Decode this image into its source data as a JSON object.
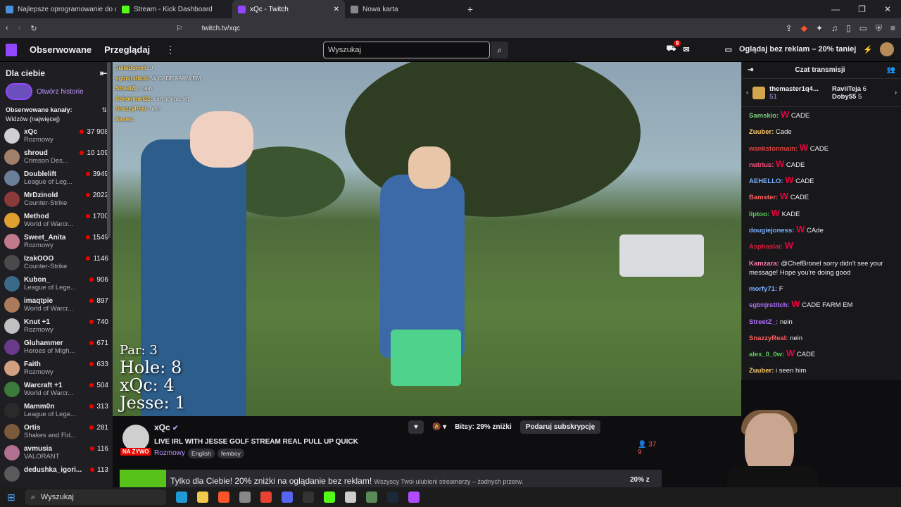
{
  "browser": {
    "tabs": [
      {
        "label": "Najlepsze oprogramowanie do ulepsz",
        "color": "#4a90d9"
      },
      {
        "label": "Stream - Kick Dashboard",
        "color": "#53fc18"
      },
      {
        "label": "xQc - Twitch",
        "color": "#9147ff"
      },
      {
        "label": "Nowa karta",
        "color": "#888888"
      }
    ],
    "url": "twitch.tv/xqc"
  },
  "header": {
    "followed": "Obserwowane",
    "browse": "Przeglądaj",
    "search_placeholder": "Wyszukaj",
    "notif_count": "9",
    "ad_free": "Oglądaj bez reklam – 20% taniej"
  },
  "sidebar": {
    "title": "Dla ciebie",
    "stories": "Otwórz historie",
    "followed_label": "Obserwowane kanały:",
    "sort": "Widzów (najwięcej)",
    "channels": [
      {
        "name": "xQc",
        "cat": "Rozmowy",
        "viewers": "37 908",
        "color": "#d0d0d0"
      },
      {
        "name": "shroud",
        "cat": "Crimson Des...",
        "viewers": "10 109",
        "color": "#a0806a"
      },
      {
        "name": "Doublelift",
        "cat": "League of Leg...",
        "viewers": "3949",
        "color": "#6a7f9a"
      },
      {
        "name": "MrDzinold",
        "cat": "Counter-Strike",
        "viewers": "2022",
        "color": "#8a3a3a"
      },
      {
        "name": "Method",
        "cat": "World of Warcr...",
        "viewers": "1700",
        "color": "#e0a030"
      },
      {
        "name": "Sweet_Anita",
        "cat": "Rozmowy",
        "viewers": "1549",
        "color": "#c07a8a"
      },
      {
        "name": "IzakOOO",
        "cat": "Counter-Strike",
        "viewers": "1146",
        "color": "#4a4a4a"
      },
      {
        "name": "Kubon_",
        "cat": "League of Lege...",
        "viewers": "906",
        "color": "#3a6a8a"
      },
      {
        "name": "imaqtpie",
        "cat": "World of Warcr...",
        "viewers": "897",
        "color": "#aa7a5a"
      },
      {
        "name": "Knut +1",
        "cat": "Rozmowy",
        "viewers": "740",
        "color": "#c0c0c0"
      },
      {
        "name": "Gluhammer",
        "cat": "Heroes of Migh...",
        "viewers": "671",
        "color": "#6a3a8a"
      },
      {
        "name": "Faith",
        "cat": "Rozmowy",
        "viewers": "633",
        "color": "#d0a080"
      },
      {
        "name": "Warcraft +1",
        "cat": "World of Warcr...",
        "viewers": "504",
        "color": "#3a7a3a"
      },
      {
        "name": "Mamm0n",
        "cat": "League of Lege...",
        "viewers": "313",
        "color": "#2a2a2a"
      },
      {
        "name": "Ortis",
        "cat": "Shakes and Fid...",
        "viewers": "281",
        "color": "#7a5a3a"
      },
      {
        "name": "avmusia",
        "cat": "VALORANT",
        "viewers": "116",
        "color": "#b07090"
      },
      {
        "name": "dedushka_igori...",
        "cat": "",
        "viewers": "113",
        "color": "#5a5a5a"
      }
    ]
  },
  "video": {
    "overlay_chat": [
      {
        "user": "JuliaBurrell:",
        "msg": "9"
      },
      {
        "user": "sgtmjrstitch:",
        "msg": "W CADE FARM EM"
      },
      {
        "user": "StreetZ_:",
        "msg": "nein"
      },
      {
        "user": "Schommel32:",
        "msg": "can gonna set"
      },
      {
        "user": "SnazzyReal:",
        "msg": "nein"
      },
      {
        "user": "Xenex:",
        "msg": ""
      }
    ],
    "score": {
      "par": "Par: 3",
      "hole": "Hole: 8",
      "xqc": "xQc: 4",
      "jesse": "Jesse: 1"
    }
  },
  "stream": {
    "name": "xQc",
    "live": "NA ŻYWO",
    "title": "LIVE IRL WITH JESSE GOLF STREAM REAL PULL UP QUICK",
    "category": "Rozmowy",
    "tags": [
      "English",
      "femboy"
    ],
    "bits": "Bitsy: 29% zniżki",
    "gift": "Podaruj subskrypcję",
    "viewers": "37 9",
    "promo_main": "Tylko dla Ciebie! 20% zniżki na oglądanie bez reklam!",
    "promo_sub": "Wszyscy Twoi ulubieni streamerzy – żadnych przerw.",
    "promo_badge": "20% z"
  },
  "chat": {
    "title": "Czat transmisji",
    "pinned": [
      {
        "name": "themaster1q4...",
        "count": "51"
      },
      {
        "name": "RaviiTeja",
        "count": "6"
      },
      {
        "name": "Doby55",
        "count": "5"
      }
    ],
    "messages": [
      {
        "user": "Samskio:",
        "color": "#7cd07c",
        "w": "W",
        "text": "CADE"
      },
      {
        "user": "Zuuber:",
        "color": "#ffcc66",
        "w": "",
        "text": "Cade"
      },
      {
        "user": "wankstonmain:",
        "color": "#e04040",
        "w": "W",
        "text": "CADE"
      },
      {
        "user": "nutrius:",
        "color": "#ff5080",
        "w": "W",
        "text": "CADE"
      },
      {
        "user": "AEHELLO:",
        "color": "#7ab0ff",
        "w": "W",
        "text": "CADE"
      },
      {
        "user": "Bamster:",
        "color": "#ff6060",
        "w": "W",
        "text": "CADE"
      },
      {
        "user": "liptoo:",
        "color": "#5ad05a",
        "w": "W",
        "text": "KADE"
      },
      {
        "user": "dougiejoness:",
        "color": "#7ab0ff",
        "w": "W",
        "text": "CAde"
      },
      {
        "user": "Asphaslai:",
        "color": "#d02040",
        "w": "W",
        "text": ""
      },
      {
        "user": "Kamzara:",
        "color": "#ff7ab0",
        "w": "",
        "text": "@ChefBronel sorry didn't see your message! Hope you're doing good"
      },
      {
        "user": "morfy71:",
        "color": "#7ab0ff",
        "w": "",
        "text": "F"
      },
      {
        "user": "sgtmjrstitch:",
        "color": "#b070ff",
        "w": "W",
        "text": "CADE FARM EM"
      },
      {
        "user": "StreetZ_:",
        "color": "#b070ff",
        "w": "",
        "text": "nein"
      },
      {
        "user": "SnazzyReal:",
        "color": "#ff6060",
        "w": "",
        "text": "nein"
      },
      {
        "user": "alex_0_0w:",
        "color": "#5ad05a",
        "w": "W",
        "text": "CADE"
      },
      {
        "user": "Zuuber:",
        "color": "#ffcc66",
        "w": "",
        "text": "i seen him"
      }
    ]
  },
  "taskbar": {
    "search": "Wyszukaj"
  }
}
